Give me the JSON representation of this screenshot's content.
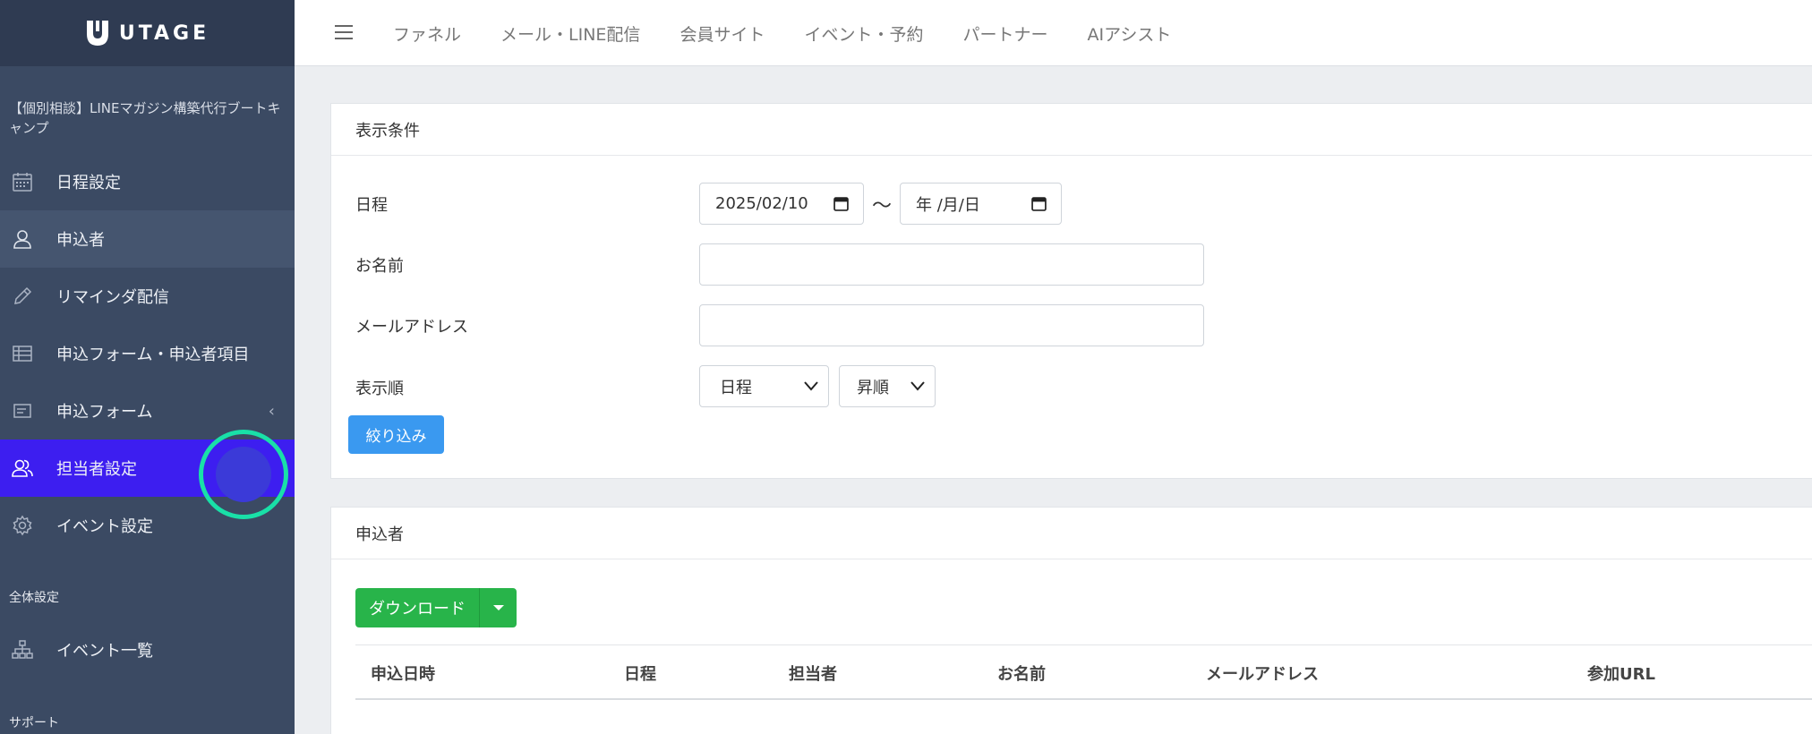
{
  "brand": {
    "name": "UTAGE"
  },
  "sidebar": {
    "project_title": "【個別相談】LINEマガジン構築代行ブートキャンプ",
    "items": [
      {
        "label": "日程設定",
        "icon": "calendar-icon"
      },
      {
        "label": "申込者",
        "icon": "user-icon"
      },
      {
        "label": "リマインダ配信",
        "icon": "pencil-icon"
      },
      {
        "label": "申込フォーム・申込者項目",
        "icon": "table-icon"
      },
      {
        "label": "申込フォーム",
        "icon": "form-icon"
      },
      {
        "label": "担当者設定",
        "icon": "users-icon"
      },
      {
        "label": "イベント設定",
        "icon": "gear-icon"
      }
    ],
    "section_global": "全体設定",
    "event_list": {
      "label": "イベント一覧",
      "icon": "sitemap-icon"
    },
    "section_support": "サポート"
  },
  "topnav": {
    "items": [
      "ファネル",
      "メール・LINE配信",
      "会員サイト",
      "イベント・予約",
      "パートナー",
      "AIアシスト"
    ]
  },
  "filter": {
    "title": "表示条件",
    "schedule_label": "日程",
    "date_from": "2025/02/10",
    "date_to": "年 /月/日",
    "tilde": "〜",
    "name_label": "お名前",
    "email_label": "メールアドレス",
    "order_label": "表示順",
    "order_field": "日程",
    "order_dir": "昇順",
    "submit": "絞り込み"
  },
  "applicants": {
    "title": "申込者",
    "download": "ダウンロード",
    "columns": [
      "申込日時",
      "日程",
      "担当者",
      "お名前",
      "メールアドレス",
      "参加URL"
    ]
  }
}
